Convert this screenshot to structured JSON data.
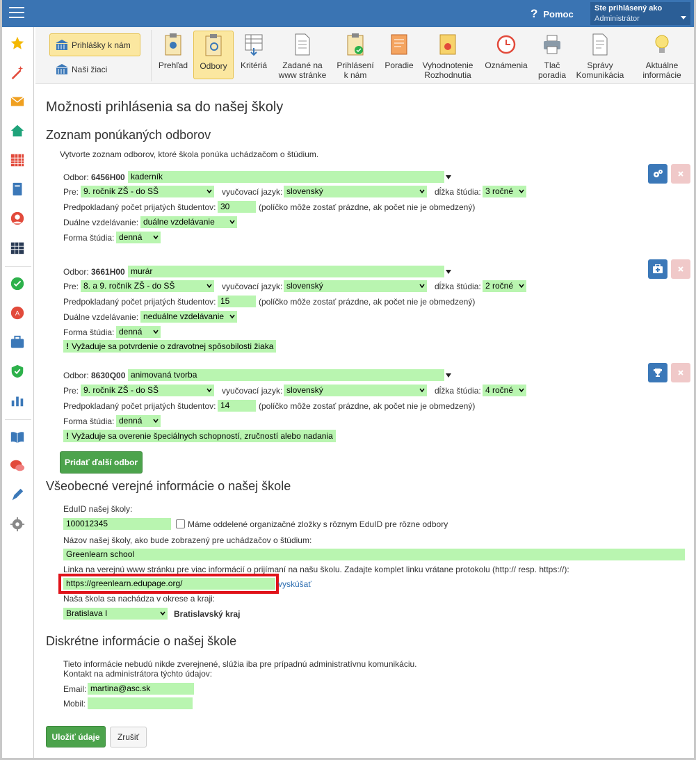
{
  "header": {
    "help_label": "Pomoc",
    "user_line1": "Ste prihlásený ako",
    "user_line2": "Administrátor"
  },
  "toolbar": {
    "main_label": "Prihlášky k nám",
    "sub_label": "Naši žiaci",
    "tools": [
      {
        "l1": "Prehľad",
        "l2": ""
      },
      {
        "l1": "Odbory",
        "l2": ""
      },
      {
        "l1": "Kritériá",
        "l2": ""
      },
      {
        "l1": "Zadané na",
        "l2": "www stránke"
      },
      {
        "l1": "Prihlásení",
        "l2": "k nám"
      },
      {
        "l1": "Poradie",
        "l2": ""
      },
      {
        "l1": "Vyhodnotenie",
        "l2": "Rozhodnutia"
      },
      {
        "l1": "Oznámenia",
        "l2": ""
      },
      {
        "l1": "Tlač",
        "l2": "poradia"
      },
      {
        "l1": "Správy",
        "l2": "Komunikácia"
      },
      {
        "l1": "Aktuálne",
        "l2": "informácie"
      }
    ]
  },
  "page": {
    "title": "Možnosti prihlásenia sa do našej školy",
    "section1_title": "Zoznam ponúkaných odborov",
    "section1_intro": "Vytvorte zoznam odborov, ktoré škola ponúka uchádzačom o štúdium.",
    "labels": {
      "odbor": "Odbor:",
      "pre": "Pre:",
      "jazyk": "vyučovací jazyk:",
      "dlzka": "dĺžka štúdia:",
      "pocet": "Predpokladaný počet prijatých študentov:",
      "pocet_note": "(políčko môže zostať prázdne, ak počet nie je obmedzený)",
      "dualne": "Duálne vzdelávanie:",
      "forma": "Forma štúdia:"
    },
    "odbory": [
      {
        "code": "6456H00",
        "name": "kaderník",
        "pre": "9. ročník ZŠ - do SŠ",
        "jazyk": "slovenský",
        "dlzka": "3 ročné",
        "pocet": "30",
        "dualne": "duálne vzdelávanie",
        "forma": "denná",
        "warning": ""
      },
      {
        "code": "3661H00",
        "name": "murár",
        "pre": "8. a 9. ročník ZŠ - do SŠ",
        "jazyk": "slovenský",
        "dlzka": "2 ročné",
        "pocet": "15",
        "dualne": "neduálne vzdelávanie",
        "forma": "denná",
        "warning": "Vyžaduje sa potvrdenie o zdravotnej spôsobilosti žiaka"
      },
      {
        "code": "8630Q00",
        "name": "animovaná tvorba",
        "pre": "9. ročník ZŠ - do SŠ",
        "jazyk": "slovenský",
        "dlzka": "4 ročné",
        "pocet": "14",
        "dualne": "",
        "forma": "denná",
        "warning": "Vyžaduje sa overenie špeciálnych schopností, zručností alebo nadania"
      }
    ],
    "add_button": "Pridať ďalší odbor",
    "section2_title": "Všeobecné verejné informácie o našej škole",
    "eduid_label": "EduID našej školy:",
    "eduid_value": "100012345",
    "eduid_checkbox": "Máme oddelené organizačné zložky s rôznym EduID pre rôzne odbory",
    "school_name_label": "Názov našej školy, ako bude zobrazený pre uchádzačov o štúdium:",
    "school_name_value": "Greenlearn school",
    "link_label": "Linka na verejnú www stránku pre viac informácií o prijímaní na našu školu. Zadajte komplet linku vrátane protokolu (http:// resp. https://):",
    "link_value": "https://greenlearn.edupage.org/",
    "link_try": "vyskúšať",
    "okres_label": "Naša škola sa nachádza v okrese a kraji:",
    "okres_value": "Bratislava I",
    "kraj_value": "Bratislavský kraj",
    "section3_title": "Diskrétne informácie o našej škole",
    "section3_intro1": "Tieto informácie nebudú nikde zverejnené, slúžia iba pre prípadnú administratívnu komunikáciu.",
    "section3_intro2": "Kontakt na administrátora týchto údajov:",
    "email_label": "Email:",
    "email_value": "martina@asc.sk",
    "mobil_label": "Mobil:",
    "mobil_value": "",
    "save_button": "Uložiť údaje",
    "cancel_button": "Zrušiť"
  }
}
